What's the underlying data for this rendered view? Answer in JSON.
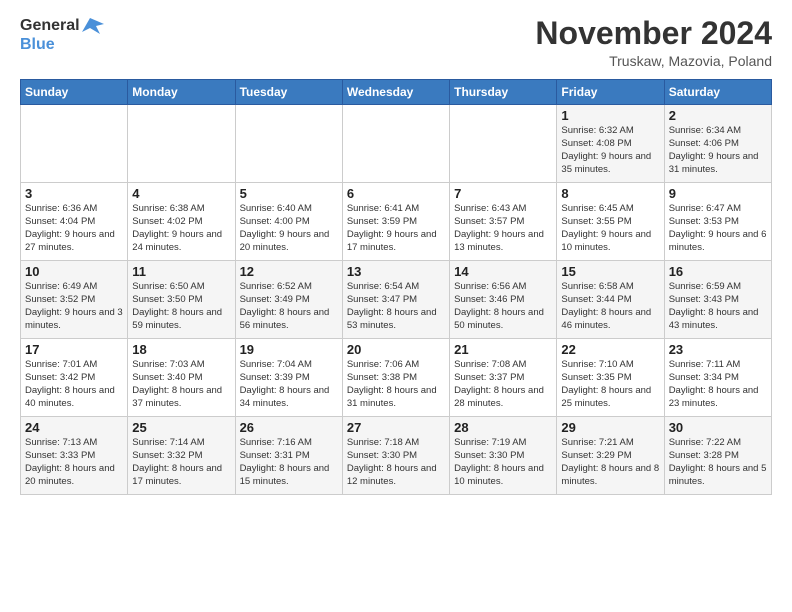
{
  "logo": {
    "line1": "General",
    "line2": "Blue"
  },
  "title": "November 2024",
  "location": "Truskaw, Mazovia, Poland",
  "days_of_week": [
    "Sunday",
    "Monday",
    "Tuesday",
    "Wednesday",
    "Thursday",
    "Friday",
    "Saturday"
  ],
  "weeks": [
    [
      {
        "day": "",
        "info": ""
      },
      {
        "day": "",
        "info": ""
      },
      {
        "day": "",
        "info": ""
      },
      {
        "day": "",
        "info": ""
      },
      {
        "day": "",
        "info": ""
      },
      {
        "day": "1",
        "info": "Sunrise: 6:32 AM\nSunset: 4:08 PM\nDaylight: 9 hours and 35 minutes."
      },
      {
        "day": "2",
        "info": "Sunrise: 6:34 AM\nSunset: 4:06 PM\nDaylight: 9 hours and 31 minutes."
      }
    ],
    [
      {
        "day": "3",
        "info": "Sunrise: 6:36 AM\nSunset: 4:04 PM\nDaylight: 9 hours and 27 minutes."
      },
      {
        "day": "4",
        "info": "Sunrise: 6:38 AM\nSunset: 4:02 PM\nDaylight: 9 hours and 24 minutes."
      },
      {
        "day": "5",
        "info": "Sunrise: 6:40 AM\nSunset: 4:00 PM\nDaylight: 9 hours and 20 minutes."
      },
      {
        "day": "6",
        "info": "Sunrise: 6:41 AM\nSunset: 3:59 PM\nDaylight: 9 hours and 17 minutes."
      },
      {
        "day": "7",
        "info": "Sunrise: 6:43 AM\nSunset: 3:57 PM\nDaylight: 9 hours and 13 minutes."
      },
      {
        "day": "8",
        "info": "Sunrise: 6:45 AM\nSunset: 3:55 PM\nDaylight: 9 hours and 10 minutes."
      },
      {
        "day": "9",
        "info": "Sunrise: 6:47 AM\nSunset: 3:53 PM\nDaylight: 9 hours and 6 minutes."
      }
    ],
    [
      {
        "day": "10",
        "info": "Sunrise: 6:49 AM\nSunset: 3:52 PM\nDaylight: 9 hours and 3 minutes."
      },
      {
        "day": "11",
        "info": "Sunrise: 6:50 AM\nSunset: 3:50 PM\nDaylight: 8 hours and 59 minutes."
      },
      {
        "day": "12",
        "info": "Sunrise: 6:52 AM\nSunset: 3:49 PM\nDaylight: 8 hours and 56 minutes."
      },
      {
        "day": "13",
        "info": "Sunrise: 6:54 AM\nSunset: 3:47 PM\nDaylight: 8 hours and 53 minutes."
      },
      {
        "day": "14",
        "info": "Sunrise: 6:56 AM\nSunset: 3:46 PM\nDaylight: 8 hours and 50 minutes."
      },
      {
        "day": "15",
        "info": "Sunrise: 6:58 AM\nSunset: 3:44 PM\nDaylight: 8 hours and 46 minutes."
      },
      {
        "day": "16",
        "info": "Sunrise: 6:59 AM\nSunset: 3:43 PM\nDaylight: 8 hours and 43 minutes."
      }
    ],
    [
      {
        "day": "17",
        "info": "Sunrise: 7:01 AM\nSunset: 3:42 PM\nDaylight: 8 hours and 40 minutes."
      },
      {
        "day": "18",
        "info": "Sunrise: 7:03 AM\nSunset: 3:40 PM\nDaylight: 8 hours and 37 minutes."
      },
      {
        "day": "19",
        "info": "Sunrise: 7:04 AM\nSunset: 3:39 PM\nDaylight: 8 hours and 34 minutes."
      },
      {
        "day": "20",
        "info": "Sunrise: 7:06 AM\nSunset: 3:38 PM\nDaylight: 8 hours and 31 minutes."
      },
      {
        "day": "21",
        "info": "Sunrise: 7:08 AM\nSunset: 3:37 PM\nDaylight: 8 hours and 28 minutes."
      },
      {
        "day": "22",
        "info": "Sunrise: 7:10 AM\nSunset: 3:35 PM\nDaylight: 8 hours and 25 minutes."
      },
      {
        "day": "23",
        "info": "Sunrise: 7:11 AM\nSunset: 3:34 PM\nDaylight: 8 hours and 23 minutes."
      }
    ],
    [
      {
        "day": "24",
        "info": "Sunrise: 7:13 AM\nSunset: 3:33 PM\nDaylight: 8 hours and 20 minutes."
      },
      {
        "day": "25",
        "info": "Sunrise: 7:14 AM\nSunset: 3:32 PM\nDaylight: 8 hours and 17 minutes."
      },
      {
        "day": "26",
        "info": "Sunrise: 7:16 AM\nSunset: 3:31 PM\nDaylight: 8 hours and 15 minutes."
      },
      {
        "day": "27",
        "info": "Sunrise: 7:18 AM\nSunset: 3:30 PM\nDaylight: 8 hours and 12 minutes."
      },
      {
        "day": "28",
        "info": "Sunrise: 7:19 AM\nSunset: 3:30 PM\nDaylight: 8 hours and 10 minutes."
      },
      {
        "day": "29",
        "info": "Sunrise: 7:21 AM\nSunset: 3:29 PM\nDaylight: 8 hours and 8 minutes."
      },
      {
        "day": "30",
        "info": "Sunrise: 7:22 AM\nSunset: 3:28 PM\nDaylight: 8 hours and 5 minutes."
      }
    ]
  ]
}
